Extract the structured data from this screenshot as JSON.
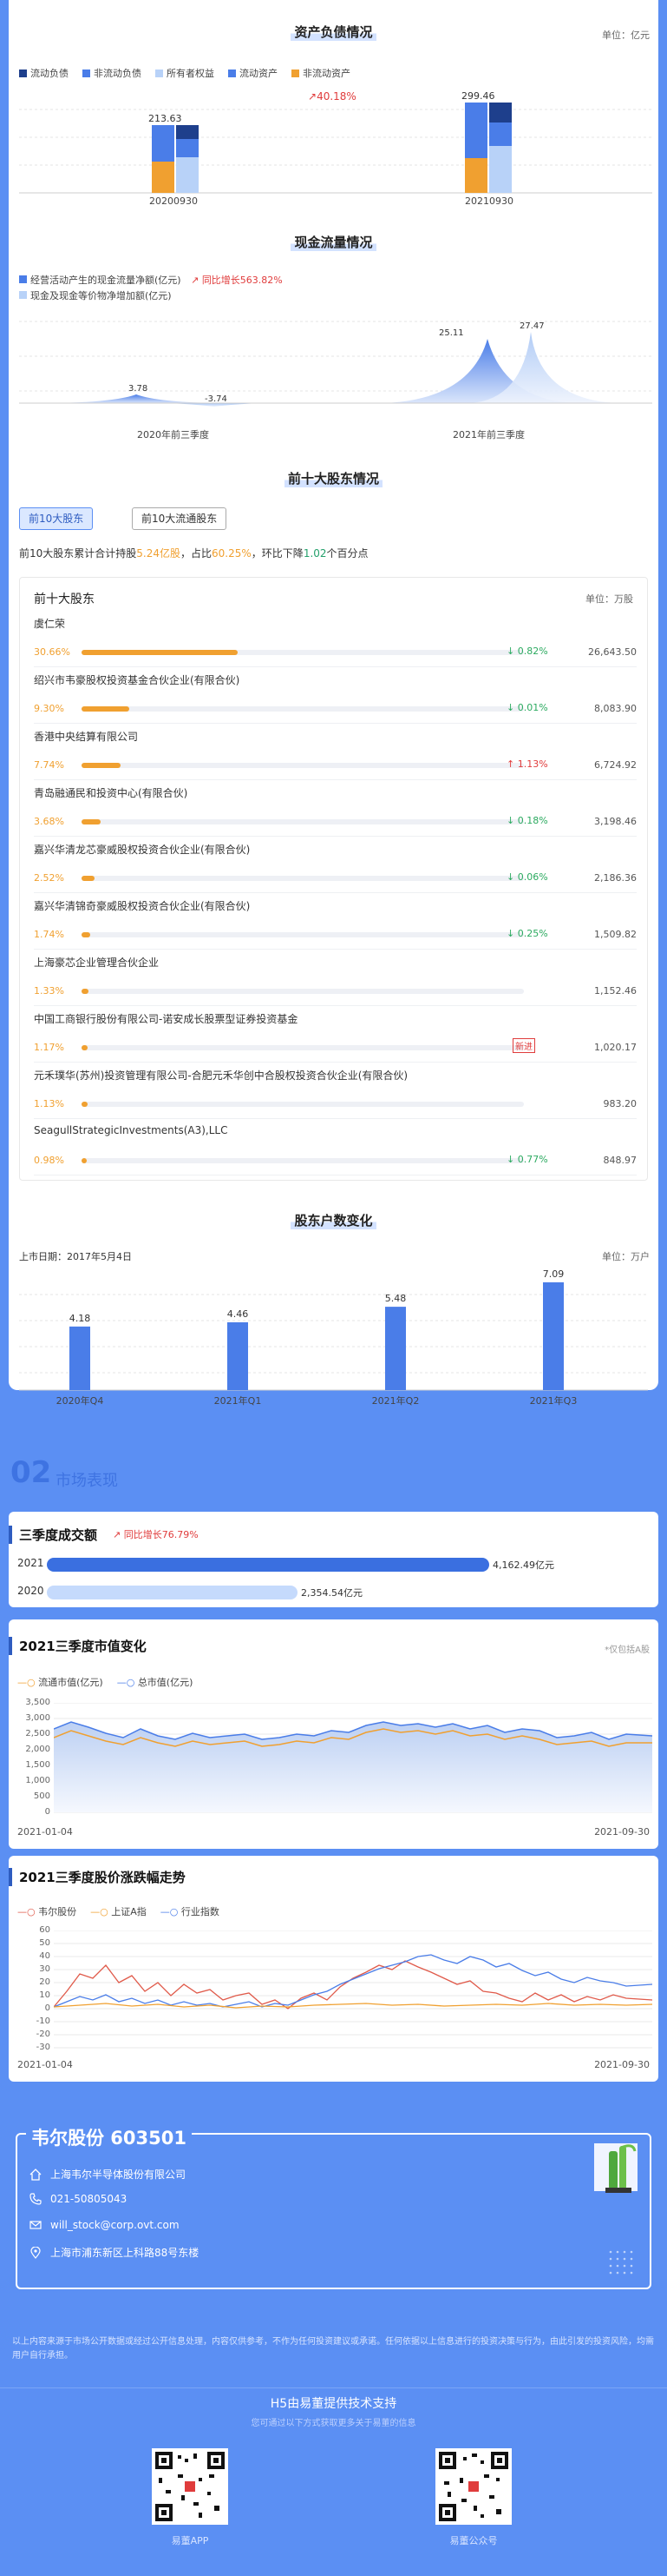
{
  "balance": {
    "title": "资产负债情况",
    "unit": "单位：亿元",
    "legend": [
      {
        "label": "流动负债",
        "color": "#1e3f8c"
      },
      {
        "label": "非流动负债",
        "color": "#4a7de8"
      },
      {
        "label": "所有者权益",
        "color": "#b8d2f8"
      },
      {
        "label": "流动资产",
        "color": "#4a7de8"
      },
      {
        "label": "非流动资产",
        "color": "#f0a030"
      }
    ],
    "growth": "40.18%",
    "periods": [
      {
        "label": "20200930",
        "total": "213.63"
      },
      {
        "label": "20210930",
        "total": "299.46"
      }
    ]
  },
  "cashflow": {
    "title": "现金流量情况",
    "legend1": "经营活动产生的现金流量净额(亿元)",
    "growth": "同比增长563.82%",
    "legend2": "现金及现金等价物净增加额(亿元)",
    "values": [
      "3.78",
      "-3.74",
      "25.11",
      "27.47"
    ],
    "categories": [
      "2020年前三季度",
      "2021年前三季度"
    ]
  },
  "shareholders": {
    "title": "前十大股东情况",
    "tab1": "前10大股东",
    "tab2": "前10大流通股东",
    "summary_a": "前10大股东累计合计持股",
    "summary_b": "5.24亿股",
    "summary_c": "，占比",
    "summary_d": "60.25%",
    "summary_e": "，环比下降",
    "summary_f": "1.02",
    "summary_g": "个百分点",
    "box_title": "前十大股东",
    "unit": "单位：万股",
    "rows": [
      {
        "name": "虞仁荣",
        "pct": "30.66%",
        "frac": 0.3066,
        "chg": "0.82%",
        "dir": "down",
        "val": "26,643.50"
      },
      {
        "name": "绍兴市韦豪股权投资基金合伙企业(有限合伙)",
        "pct": "9.30%",
        "frac": 0.093,
        "chg": "0.01%",
        "dir": "down",
        "val": "8,083.90"
      },
      {
        "name": "香港中央结算有限公司",
        "pct": "7.74%",
        "frac": 0.0774,
        "chg": "1.13%",
        "dir": "up",
        "val": "6,724.92"
      },
      {
        "name": "青岛融通民和投资中心(有限合伙)",
        "pct": "3.68%",
        "frac": 0.0368,
        "chg": "0.18%",
        "dir": "down",
        "val": "3,198.46"
      },
      {
        "name": "嘉兴华清龙芯豪威股权投资合伙企业(有限合伙)",
        "pct": "2.52%",
        "frac": 0.0252,
        "chg": "0.06%",
        "dir": "down",
        "val": "2,186.36"
      },
      {
        "name": "嘉兴华清锦奇豪威股权投资合伙企业(有限合伙)",
        "pct": "1.74%",
        "frac": 0.0174,
        "chg": "0.25%",
        "dir": "down",
        "val": "1,509.82"
      },
      {
        "name": "上海豪芯企业管理合伙企业",
        "pct": "1.33%",
        "frac": 0.0133,
        "chg": "",
        "dir": "",
        "val": "1,152.46"
      },
      {
        "name": "中国工商银行股份有限公司-诺安成长股票型证券投资基金",
        "pct": "1.17%",
        "frac": 0.0117,
        "chg": "",
        "dir": "new",
        "val": "1,020.17"
      },
      {
        "name": "元禾璞华(苏州)投资管理有限公司-合肥元禾华创中合股权投资合伙企业(有限合伙)",
        "pct": "1.13%",
        "frac": 0.0113,
        "chg": "",
        "dir": "",
        "val": "983.20"
      },
      {
        "name": "SeagullStrategicInvestments(A3),LLC",
        "pct": "0.98%",
        "frac": 0.0098,
        "chg": "0.77%",
        "dir": "down",
        "val": "848.97"
      }
    ],
    "new_label": "新进"
  },
  "holders": {
    "title": "股东户数变化",
    "list_date": "上市日期：2017年5月4日",
    "unit": "单位：万户",
    "categories": [
      "2020年Q4",
      "2021年Q1",
      "2021年Q2",
      "2021年Q3"
    ],
    "values": [
      4.18,
      4.46,
      5.48,
      7.09
    ],
    "labels": [
      "4.18",
      "4.46",
      "5.48",
      "7.09"
    ]
  },
  "section2": {
    "num": "02",
    "title": "市场表现"
  },
  "turnover": {
    "title": "三季度成交额",
    "growth": "同比增长76.79%",
    "rows": [
      {
        "year": "2021",
        "value": "4,162.49亿元",
        "frac": 1.0
      },
      {
        "year": "2020",
        "value": "2,354.54亿元",
        "frac": 0.566
      }
    ]
  },
  "marketcap": {
    "title": "2021三季度市值变化",
    "note": "*仅包括A股",
    "legend": [
      "流通市值(亿元)",
      "总市值(亿元)"
    ],
    "yticks": [
      "3,500",
      "3,000",
      "2,500",
      "2,000",
      "1,500",
      "1,000",
      "500",
      "0"
    ],
    "start": "2021-01-04",
    "end": "2021-09-30"
  },
  "price": {
    "title": "2021三季度股价涨跌幅走势",
    "legend": [
      "韦尔股份",
      "上证A指",
      "行业指数"
    ],
    "yticks": [
      "60",
      "50",
      "40",
      "30",
      "20",
      "10",
      "0",
      "-10",
      "-20",
      "-30"
    ],
    "start": "2021-01-04",
    "end": "2021-09-30"
  },
  "company": {
    "title": "韦尔股份 603501",
    "name": "上海韦尔半导体股份有限公司",
    "phone": "021-50805043",
    "email": "will_stock@corp.ovt.com",
    "address": "上海市浦东新区上科路88号东楼"
  },
  "footer": {
    "disclaimer": "以上内容来源于市场公开数据或经过公开信息处理，内容仅供参考，不作为任何投资建议或承诺。任何依据以上信息进行的投资决策与行为，由此引发的投资风险，均需用户自行承担。",
    "support": "H5由易董提供技术支持",
    "support_sub": "您可通过以下方式获取更多关于易董的信息",
    "qr1": "易董APP",
    "qr2": "易董公众号"
  },
  "colors": {
    "brand": "#5b8ff3",
    "dark_blue": "#1e3f8c",
    "mid_blue": "#4a7de8",
    "light_blue": "#b8d2f8",
    "orange": "#f0a030",
    "red": "#e03c3c",
    "green": "#2caa60"
  }
}
